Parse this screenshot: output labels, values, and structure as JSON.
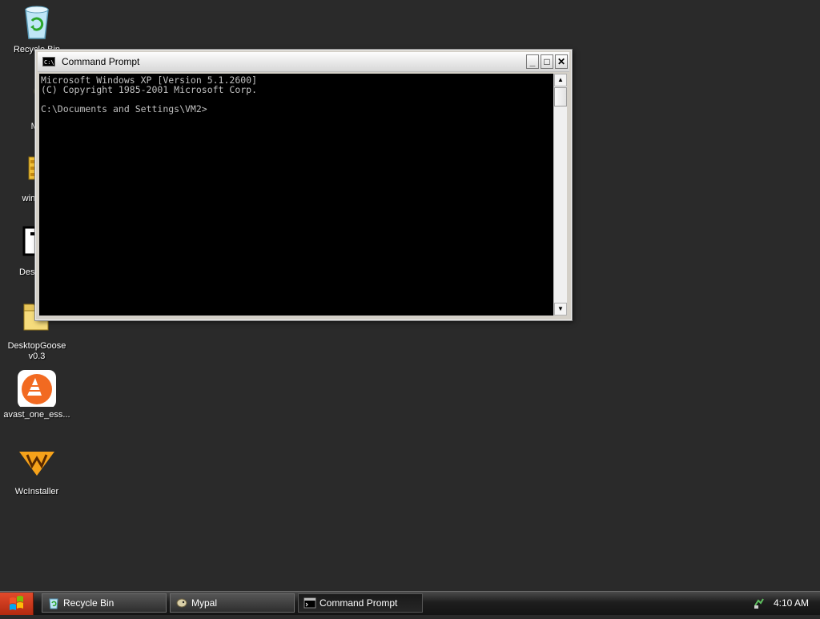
{
  "desktop": {
    "icons": [
      {
        "label": "Recycle Bin"
      },
      {
        "label": "My"
      },
      {
        "label": "winzip2"
      },
      {
        "label": "Desktop("
      },
      {
        "label": "DesktopGoose v0.3"
      },
      {
        "label": "avast_one_ess..."
      },
      {
        "label": "WcInstaller"
      }
    ]
  },
  "window": {
    "title": "Command Prompt",
    "console_lines": [
      "Microsoft Windows XP [Version 5.1.2600]",
      "(C) Copyright 1985-2001 Microsoft Corp.",
      "",
      "C:\\Documents and Settings\\VM2>"
    ],
    "buttons": {
      "minimize": "_",
      "maximize": "□",
      "close": "✕"
    }
  },
  "taskbar": {
    "items": [
      {
        "label": "Recycle Bin"
      },
      {
        "label": "Mypal"
      },
      {
        "label": "Command Prompt"
      }
    ],
    "clock": "4:10 AM"
  },
  "colors": {
    "desktop": "#2a2a2a",
    "console_bg": "#000000",
    "console_fg": "#c0c0c0"
  }
}
